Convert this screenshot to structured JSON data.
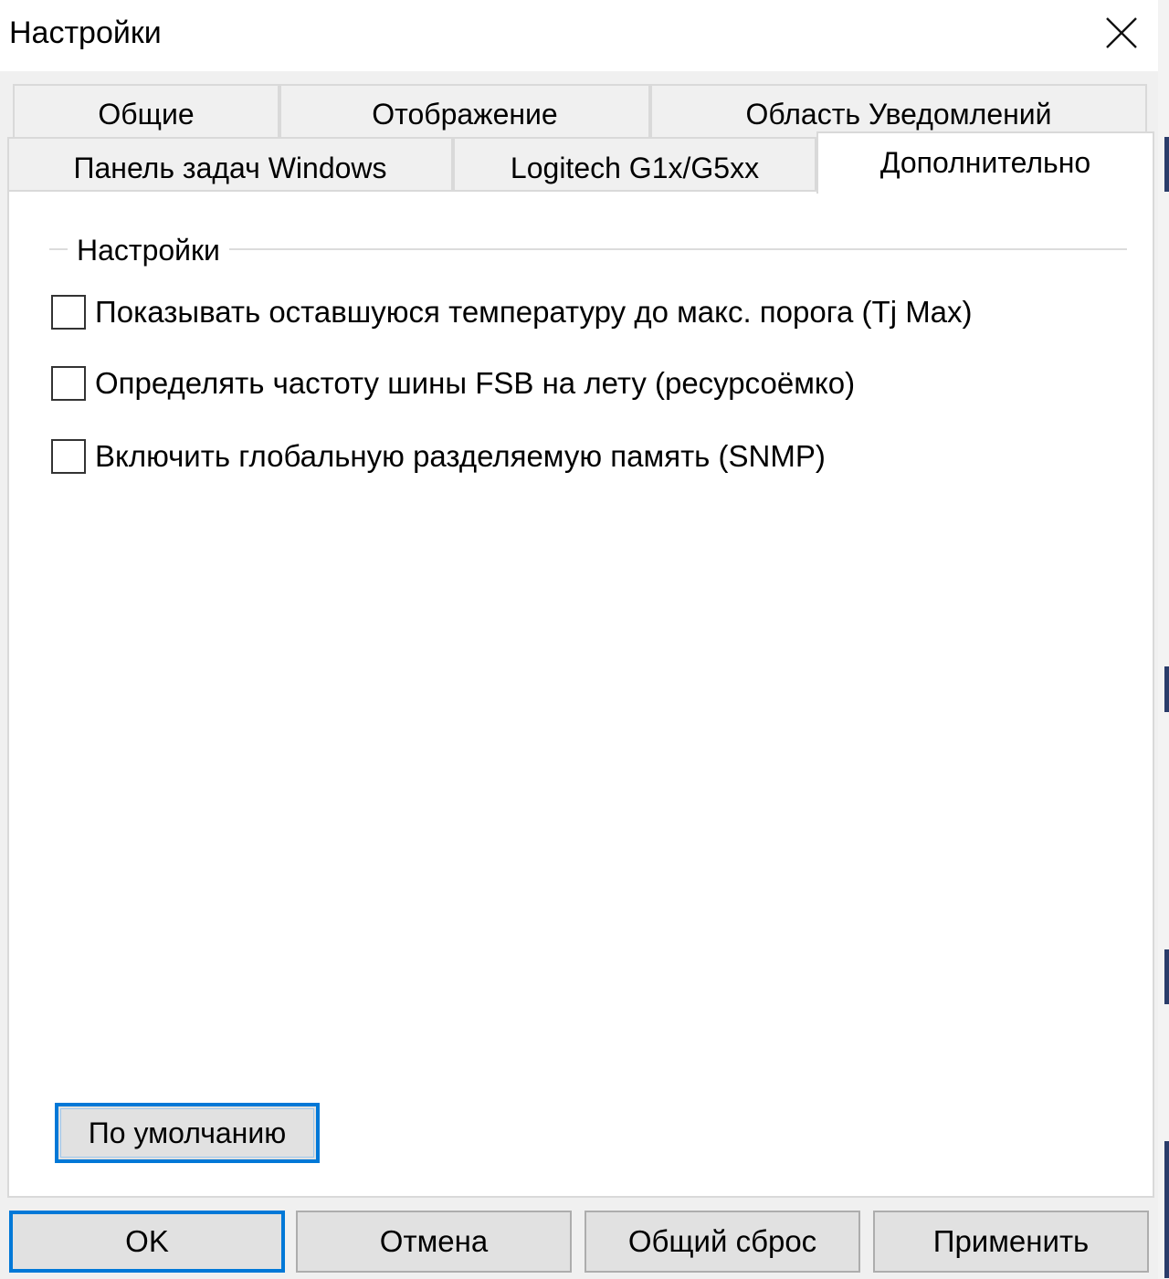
{
  "window": {
    "title": "Настройки",
    "close_icon": "close-icon"
  },
  "tabs": {
    "row1": [
      {
        "label": "Общие"
      },
      {
        "label": "Отображение"
      },
      {
        "label": "Область Уведомлений"
      }
    ],
    "row2": [
      {
        "label": "Панель задач Windows"
      },
      {
        "label": "Logitech G1x/G5xx"
      },
      {
        "label": "Дополнительно",
        "active": true
      }
    ]
  },
  "settings_group": {
    "label": "Настройки",
    "options": [
      {
        "label": "Показывать оставшуюся температуру до макс. порога (Tj Max)",
        "checked": false
      },
      {
        "label": "Определять частоту шины FSB на лету (ресурсоёмко)",
        "checked": false
      },
      {
        "label": "Включить глобальную разделяемую память (SNMP)",
        "checked": false
      }
    ]
  },
  "default_button": "По умолчанию",
  "footer": {
    "ok": "OK",
    "cancel": "Отмена",
    "reset": "Общий сброс",
    "apply": "Применить"
  },
  "colors": {
    "focus_border": "#0078d7",
    "button_face": "#e1e1e1",
    "dialog_background": "#f0f0f0"
  }
}
